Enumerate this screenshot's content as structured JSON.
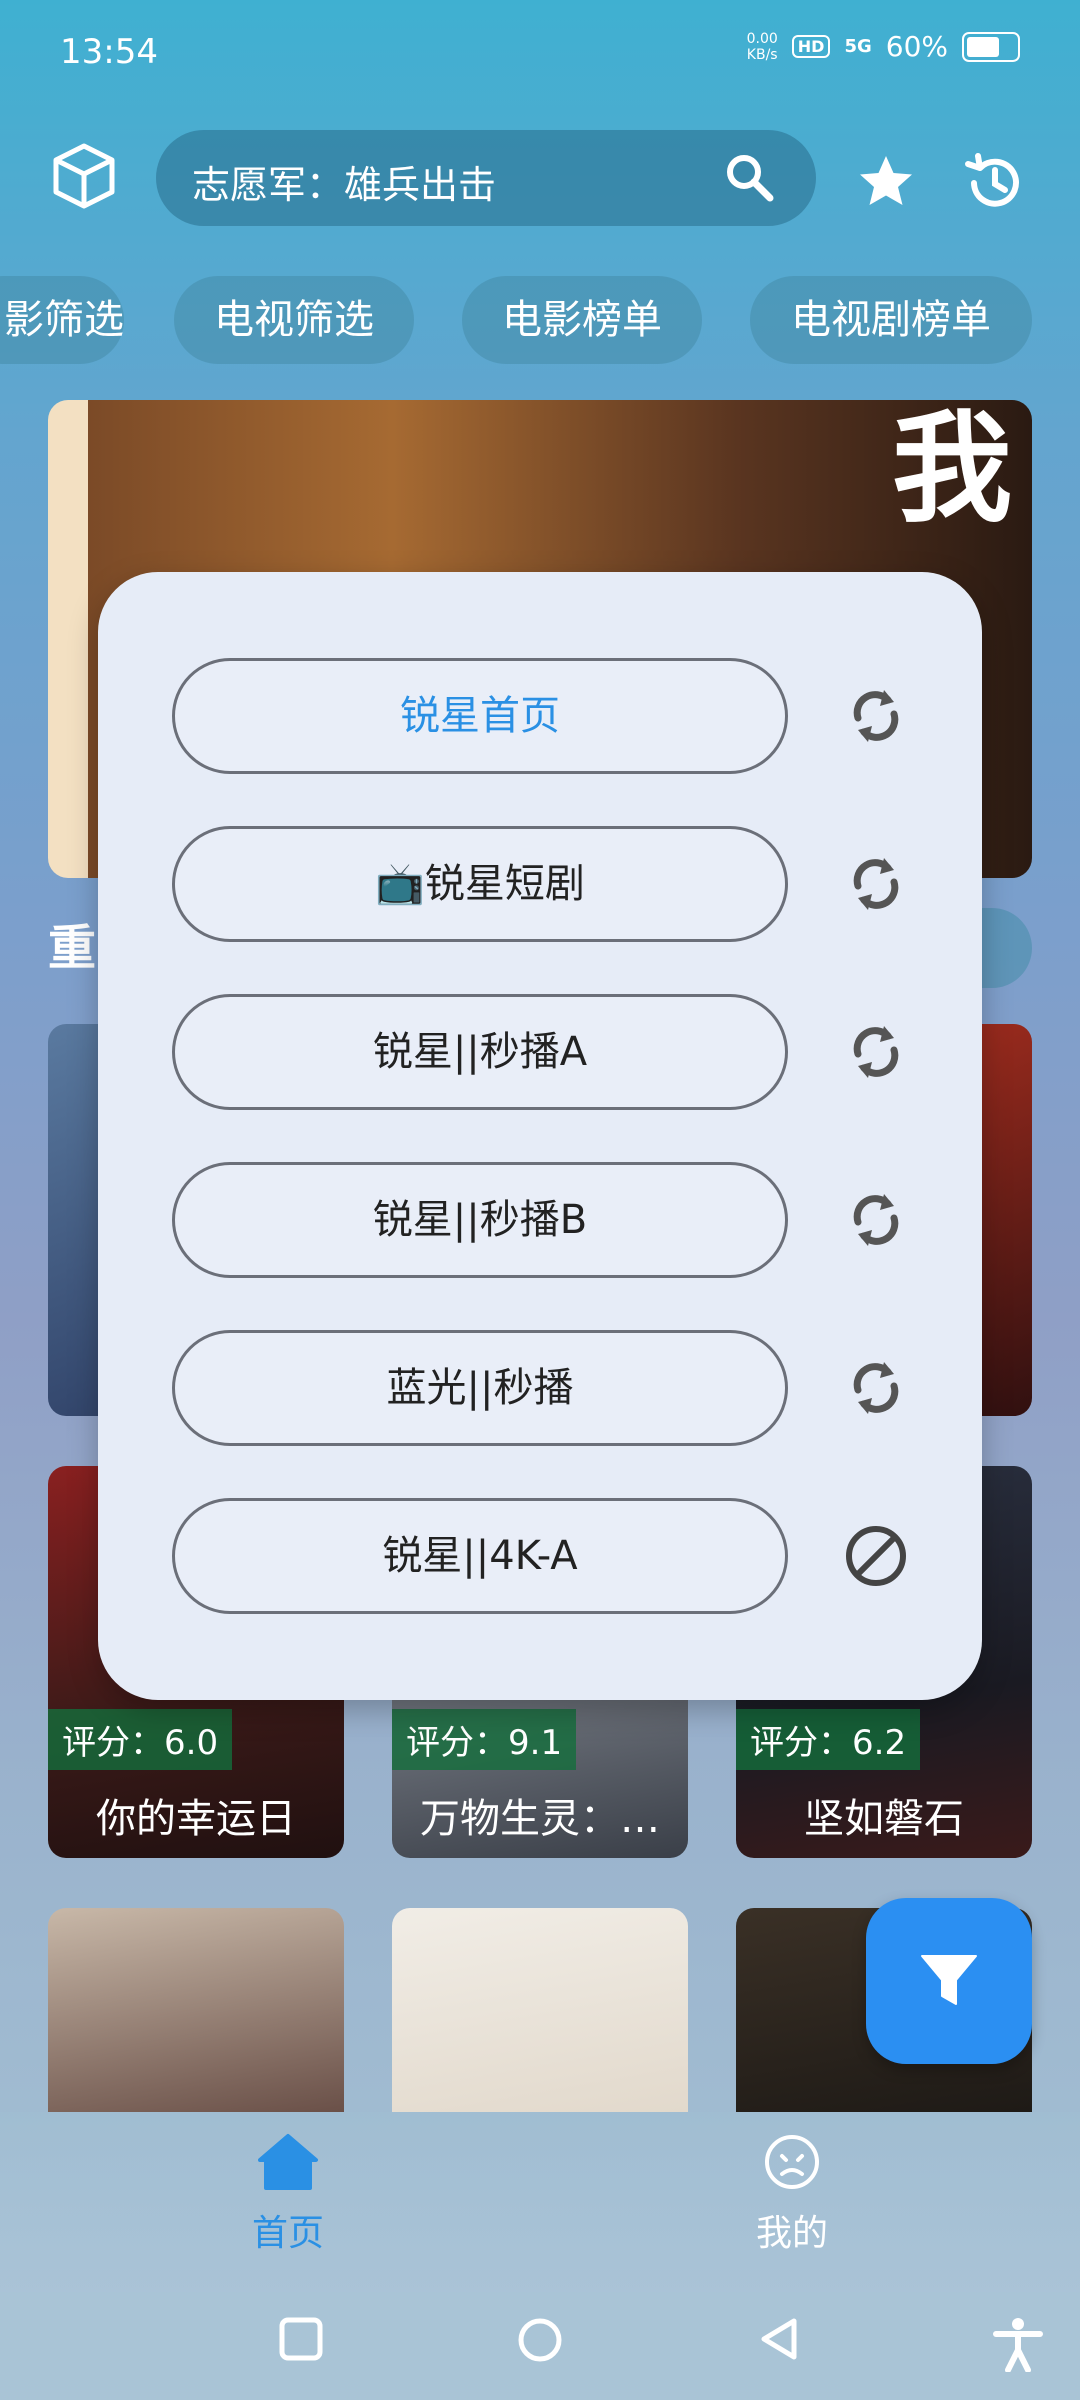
{
  "status_bar": {
    "time": "13:54",
    "net_speed_value": "0.00",
    "net_speed_unit": "KB/s",
    "hd": "HD",
    "signal": "5G",
    "battery": "60%",
    "battery_level": 0.6
  },
  "header": {
    "logo_icon": "cube-icon",
    "search_text": "志愿军：雄兵出击",
    "search_icon": "search-icon",
    "favorite_icon": "star-icon",
    "history_icon": "history-icon"
  },
  "chips": [
    "影筛选",
    "电视筛选",
    "电影榜单",
    "电视剧榜单"
  ],
  "section": {
    "title": "重"
  },
  "cards_row2": [
    {
      "score": "评分：6.0",
      "name": "你的幸运日"
    },
    {
      "score": "评分：9.1",
      "name": "万物生灵：…"
    },
    {
      "score": "评分：6.2",
      "name": "坚如磐石"
    }
  ],
  "bottom_nav": [
    {
      "label": "首页",
      "icon": "home-icon",
      "active": true
    },
    {
      "label": "我的",
      "icon": "profile-icon",
      "active": false
    }
  ],
  "source_modal": {
    "sources": [
      {
        "label": "锐星首页",
        "action_icon": "refresh-icon",
        "active": true
      },
      {
        "label": "📺锐星短剧",
        "action_icon": "refresh-icon",
        "active": false
      },
      {
        "label": "锐星||秒播A",
        "action_icon": "refresh-icon",
        "active": false
      },
      {
        "label": "锐星||秒播B",
        "action_icon": "refresh-icon",
        "active": false
      },
      {
        "label": "蓝光||秒播",
        "action_icon": "refresh-icon",
        "active": false
      },
      {
        "label": "锐星||4K-A",
        "action_icon": "block-icon",
        "active": false
      }
    ]
  },
  "colors": {
    "accent": "#2a90e4",
    "fab": "#2b8ff2",
    "modal_bg": "#e6ecf7"
  },
  "fab_icon": "filter-icon"
}
